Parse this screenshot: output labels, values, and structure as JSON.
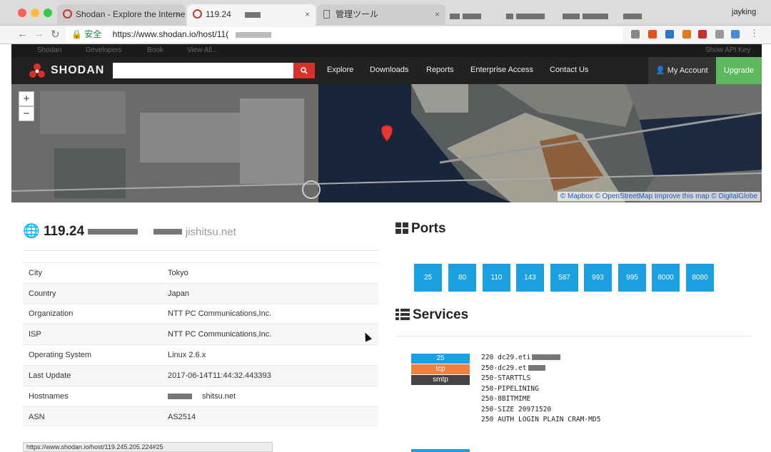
{
  "browser": {
    "user": "jayking",
    "tabs": [
      {
        "title": "Shodan - Explore the Interne"
      },
      {
        "title": "119.24"
      },
      {
        "title": "管理ツール"
      }
    ],
    "secure_label": "安全",
    "url": "https://www.shodan.io/host/11(",
    "status_url": "https://www.shodan.io/host/119.245.205.224#25"
  },
  "site": {
    "topbar": [
      "Shodan",
      "Developers",
      "Book",
      "View All...",
      "Show API Key"
    ],
    "logo": "SHODAN",
    "nav": [
      "Explore",
      "Downloads",
      "Reports",
      "Enterprise Access",
      "Contact Us"
    ],
    "account": "My Account",
    "upgrade": "Upgrade"
  },
  "map": {
    "attribution": "© Mapbox © OpenStreetMap Improve this map © DigitalGlobe",
    "zoom_in": "+",
    "zoom_out": "−"
  },
  "host": {
    "ip": "119.24",
    "hostname_suffix": "jishitsu.net",
    "rows": [
      {
        "key": "City",
        "value": "Tokyo"
      },
      {
        "key": "Country",
        "value": "Japan"
      },
      {
        "key": "Organization",
        "value": "NTT PC Communications,Inc."
      },
      {
        "key": "ISP",
        "value": "NTT PC Communications,Inc."
      },
      {
        "key": "Operating System",
        "value": "Linux 2.6.x"
      },
      {
        "key": "Last Update",
        "value": "2017-06-14T11:44:32.443393"
      },
      {
        "key": "Hostnames",
        "value": "shitsu.net"
      },
      {
        "key": "ASN",
        "value": "AS2514"
      }
    ]
  },
  "ports": {
    "heading": "Ports",
    "list": [
      "25",
      "80",
      "110",
      "143",
      "587",
      "993",
      "995",
      "8000",
      "8080"
    ]
  },
  "services": {
    "heading": "Services",
    "port": "25",
    "proto": "tcp",
    "service": "smtp",
    "banner_lines": [
      "220 dc29.eti",
      "250-dc29.et",
      "250-STARTTLS",
      "250-PIPELINING",
      "250-8BITMIME",
      "250-SIZE 20971520",
      "250 AUTH LOGIN PLAIN CRAM-MD5"
    ]
  },
  "colors": {
    "port_tile": "#1ba0e2",
    "badge_port": "#1ba0e2",
    "badge_proto": "#f0813f",
    "badge_service": "#444444",
    "upgrade": "#5cb85c",
    "search_button": "#d9302a"
  }
}
